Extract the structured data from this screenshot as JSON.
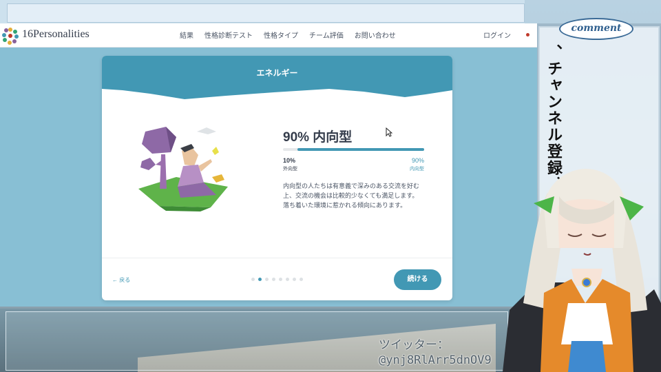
{
  "site": {
    "logo_text": "16Personalities",
    "nav": [
      "結果",
      "性格診断テスト",
      "性格タイプ",
      "チーム評価",
      "お問い合わせ"
    ],
    "login": "ログイン"
  },
  "card": {
    "title": "エネルギー",
    "headline": "90% 内向型",
    "progress": 0.9,
    "left_pct": "10%",
    "left_label": "外向型",
    "right_pct": "90%",
    "right_label": "内向型",
    "description": [
      "内向型の人たちは有意義で深みのある交流を好む",
      "上、交流の機会は比較的少なくても満足します。",
      "落ち着いた環境に惹かれる傾向にあります。"
    ],
    "back": "← 戻る",
    "continue": "続ける",
    "dots_total": 8,
    "dots_active": 1
  },
  "stream": {
    "comment_label": "comment",
    "vertical_text": "、チャンネル登録、い",
    "twitter_label": "ツイッター：",
    "twitter_handle": "@ynj8RlArr5dnOV9"
  },
  "colors": {
    "accent": "#4298b4",
    "header_band": "#4298b4",
    "site_bg": "#88bfd4"
  }
}
